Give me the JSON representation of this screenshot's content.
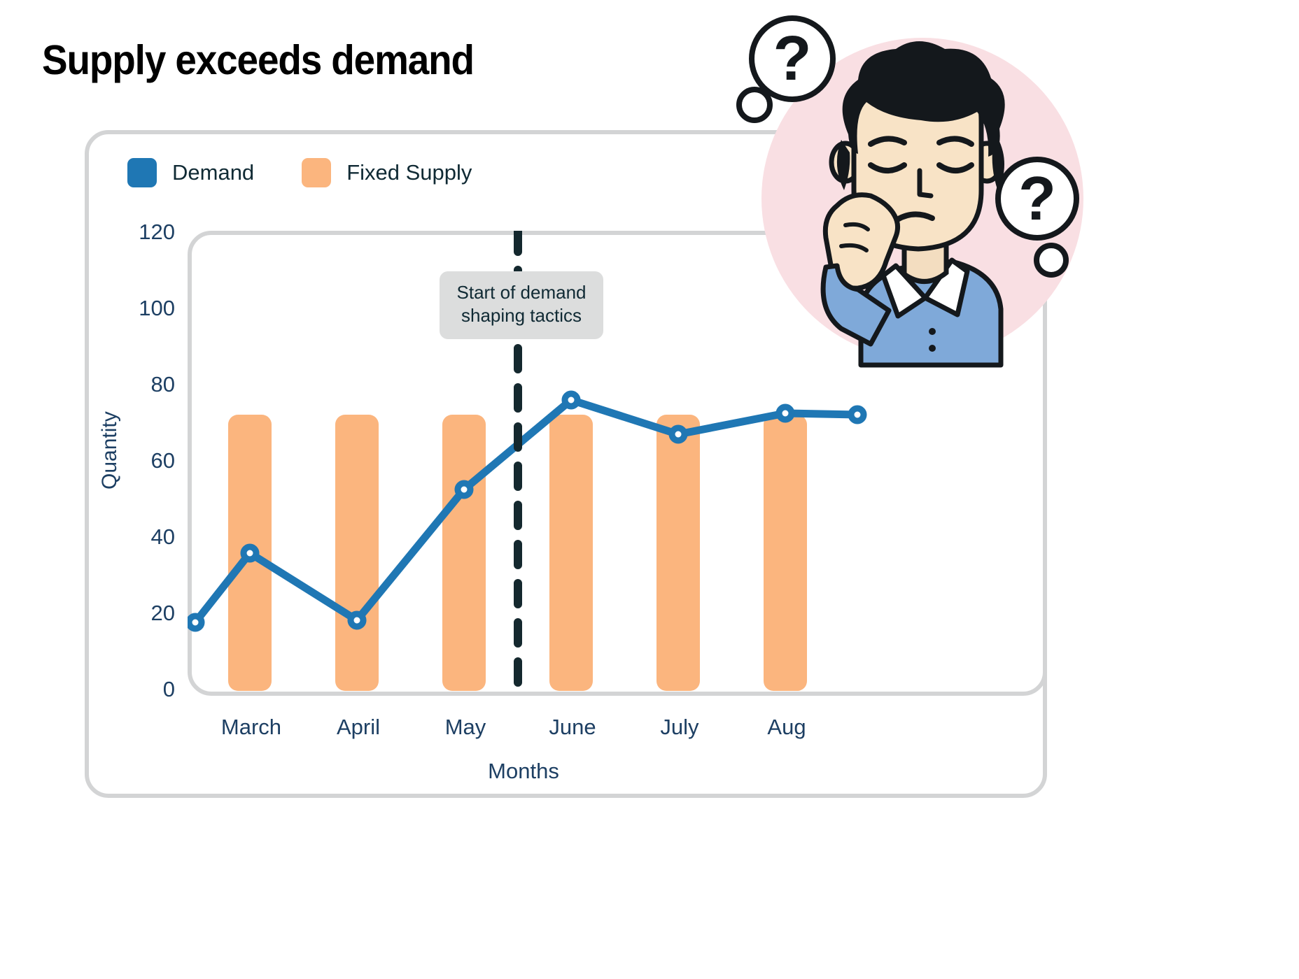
{
  "title": "Supply exceeds demand",
  "legend": {
    "items": [
      {
        "label": "Demand",
        "color": "#1f77b4"
      },
      {
        "label": "Fixed Supply",
        "color": "#fbb57e"
      }
    ]
  },
  "annotation": {
    "line1": "Start of demand",
    "line2": "shaping tactics"
  },
  "axis": {
    "y_title": "Quantity",
    "x_title": "Months",
    "y_ticks": [
      "120",
      "100",
      "80",
      "60",
      "40",
      "20",
      "0"
    ],
    "x_ticks": [
      "March",
      "April",
      "May",
      "June",
      "July",
      "Aug"
    ]
  },
  "colors": {
    "demand": "#1f77b4",
    "fixed_supply": "#fbb57e",
    "axis_text": "#1d3f63",
    "frame": "#d3d4d5",
    "annotation_bg": "#dcdddd",
    "annotation_text": "#102a34",
    "dashed_line": "#14282e",
    "illustration_bg": "#f9dfe3"
  },
  "chart_data": {
    "type": "line",
    "title": "Supply exceeds demand",
    "xlabel": "Months",
    "ylabel": "Quantity",
    "categories": [
      "March",
      "April",
      "May",
      "June",
      "July",
      "Aug"
    ],
    "ylim": [
      0,
      120
    ],
    "yticks": [
      0,
      20,
      40,
      60,
      80,
      100,
      120
    ],
    "grid": false,
    "legend_position": "top-left",
    "series": [
      {
        "name": "Fixed Supply",
        "type": "bar",
        "color": "#fbb57e",
        "values": [
          72,
          72,
          72,
          72,
          72,
          72
        ]
      },
      {
        "name": "Demand",
        "type": "line",
        "color": "#1f77b4",
        "x": [
          -0.5,
          0,
          0.5,
          1.5,
          2.5,
          3.5,
          4.5,
          5.3
        ],
        "values": [
          18,
          36,
          18.5,
          52.5,
          76,
          67,
          72.5,
          72
        ],
        "markers": "open-circle"
      }
    ],
    "annotations": [
      {
        "type": "vline",
        "label": "Start of demand shaping tactics",
        "x_between": [
          "May",
          "June"
        ],
        "style": "dashed",
        "color": "#14282e"
      }
    ]
  }
}
